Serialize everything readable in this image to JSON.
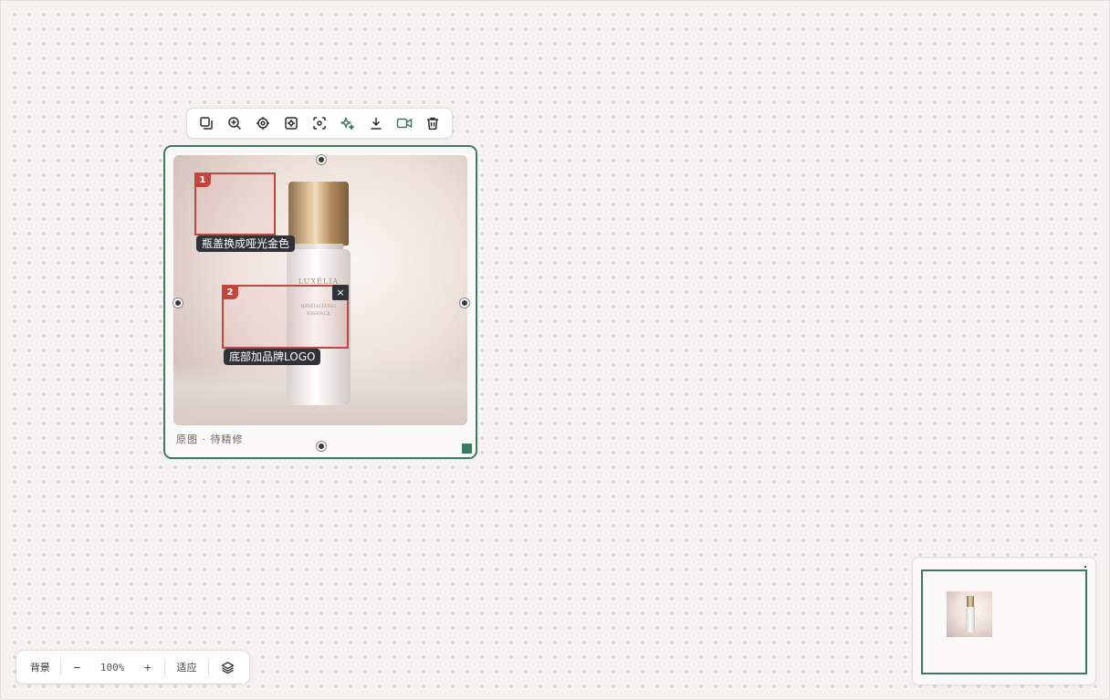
{
  "toolbar": {
    "buttons": [
      {
        "name": "duplicate-button",
        "icon": "copy-icon"
      },
      {
        "name": "zoom-in-button",
        "icon": "zoom-in-icon"
      },
      {
        "name": "locate-button",
        "icon": "target-icon"
      },
      {
        "name": "focus-button",
        "icon": "focus-square-icon"
      },
      {
        "name": "scan-button",
        "icon": "scan-icon"
      },
      {
        "name": "ai-enhance-button",
        "icon": "sparkle-icon"
      },
      {
        "name": "download-button",
        "icon": "download-icon"
      },
      {
        "name": "video-button",
        "icon": "video-icon"
      },
      {
        "name": "delete-button",
        "icon": "trash-icon"
      }
    ]
  },
  "card": {
    "caption": "原图 · 待精修",
    "product_text": {
      "brand": "LUXÉLIA",
      "line1": "REVITALIZING",
      "line2": "ESSENCE"
    },
    "annotations": [
      {
        "number": "1",
        "label": "瓶盖换成哑光金色"
      },
      {
        "number": "2",
        "label": "底部加品牌LOGO",
        "close": "×"
      }
    ]
  },
  "zoombar": {
    "background": "背景",
    "zoom_out": "−",
    "zoom_level": "100%",
    "zoom_in": "+",
    "fit": "适应",
    "layers_icon": "layers-icon"
  },
  "colors": {
    "accent": "#3f7a5e",
    "annotation": "#c0463e",
    "label_bg": "#2f3338",
    "canvas": "#f5f3ef"
  }
}
